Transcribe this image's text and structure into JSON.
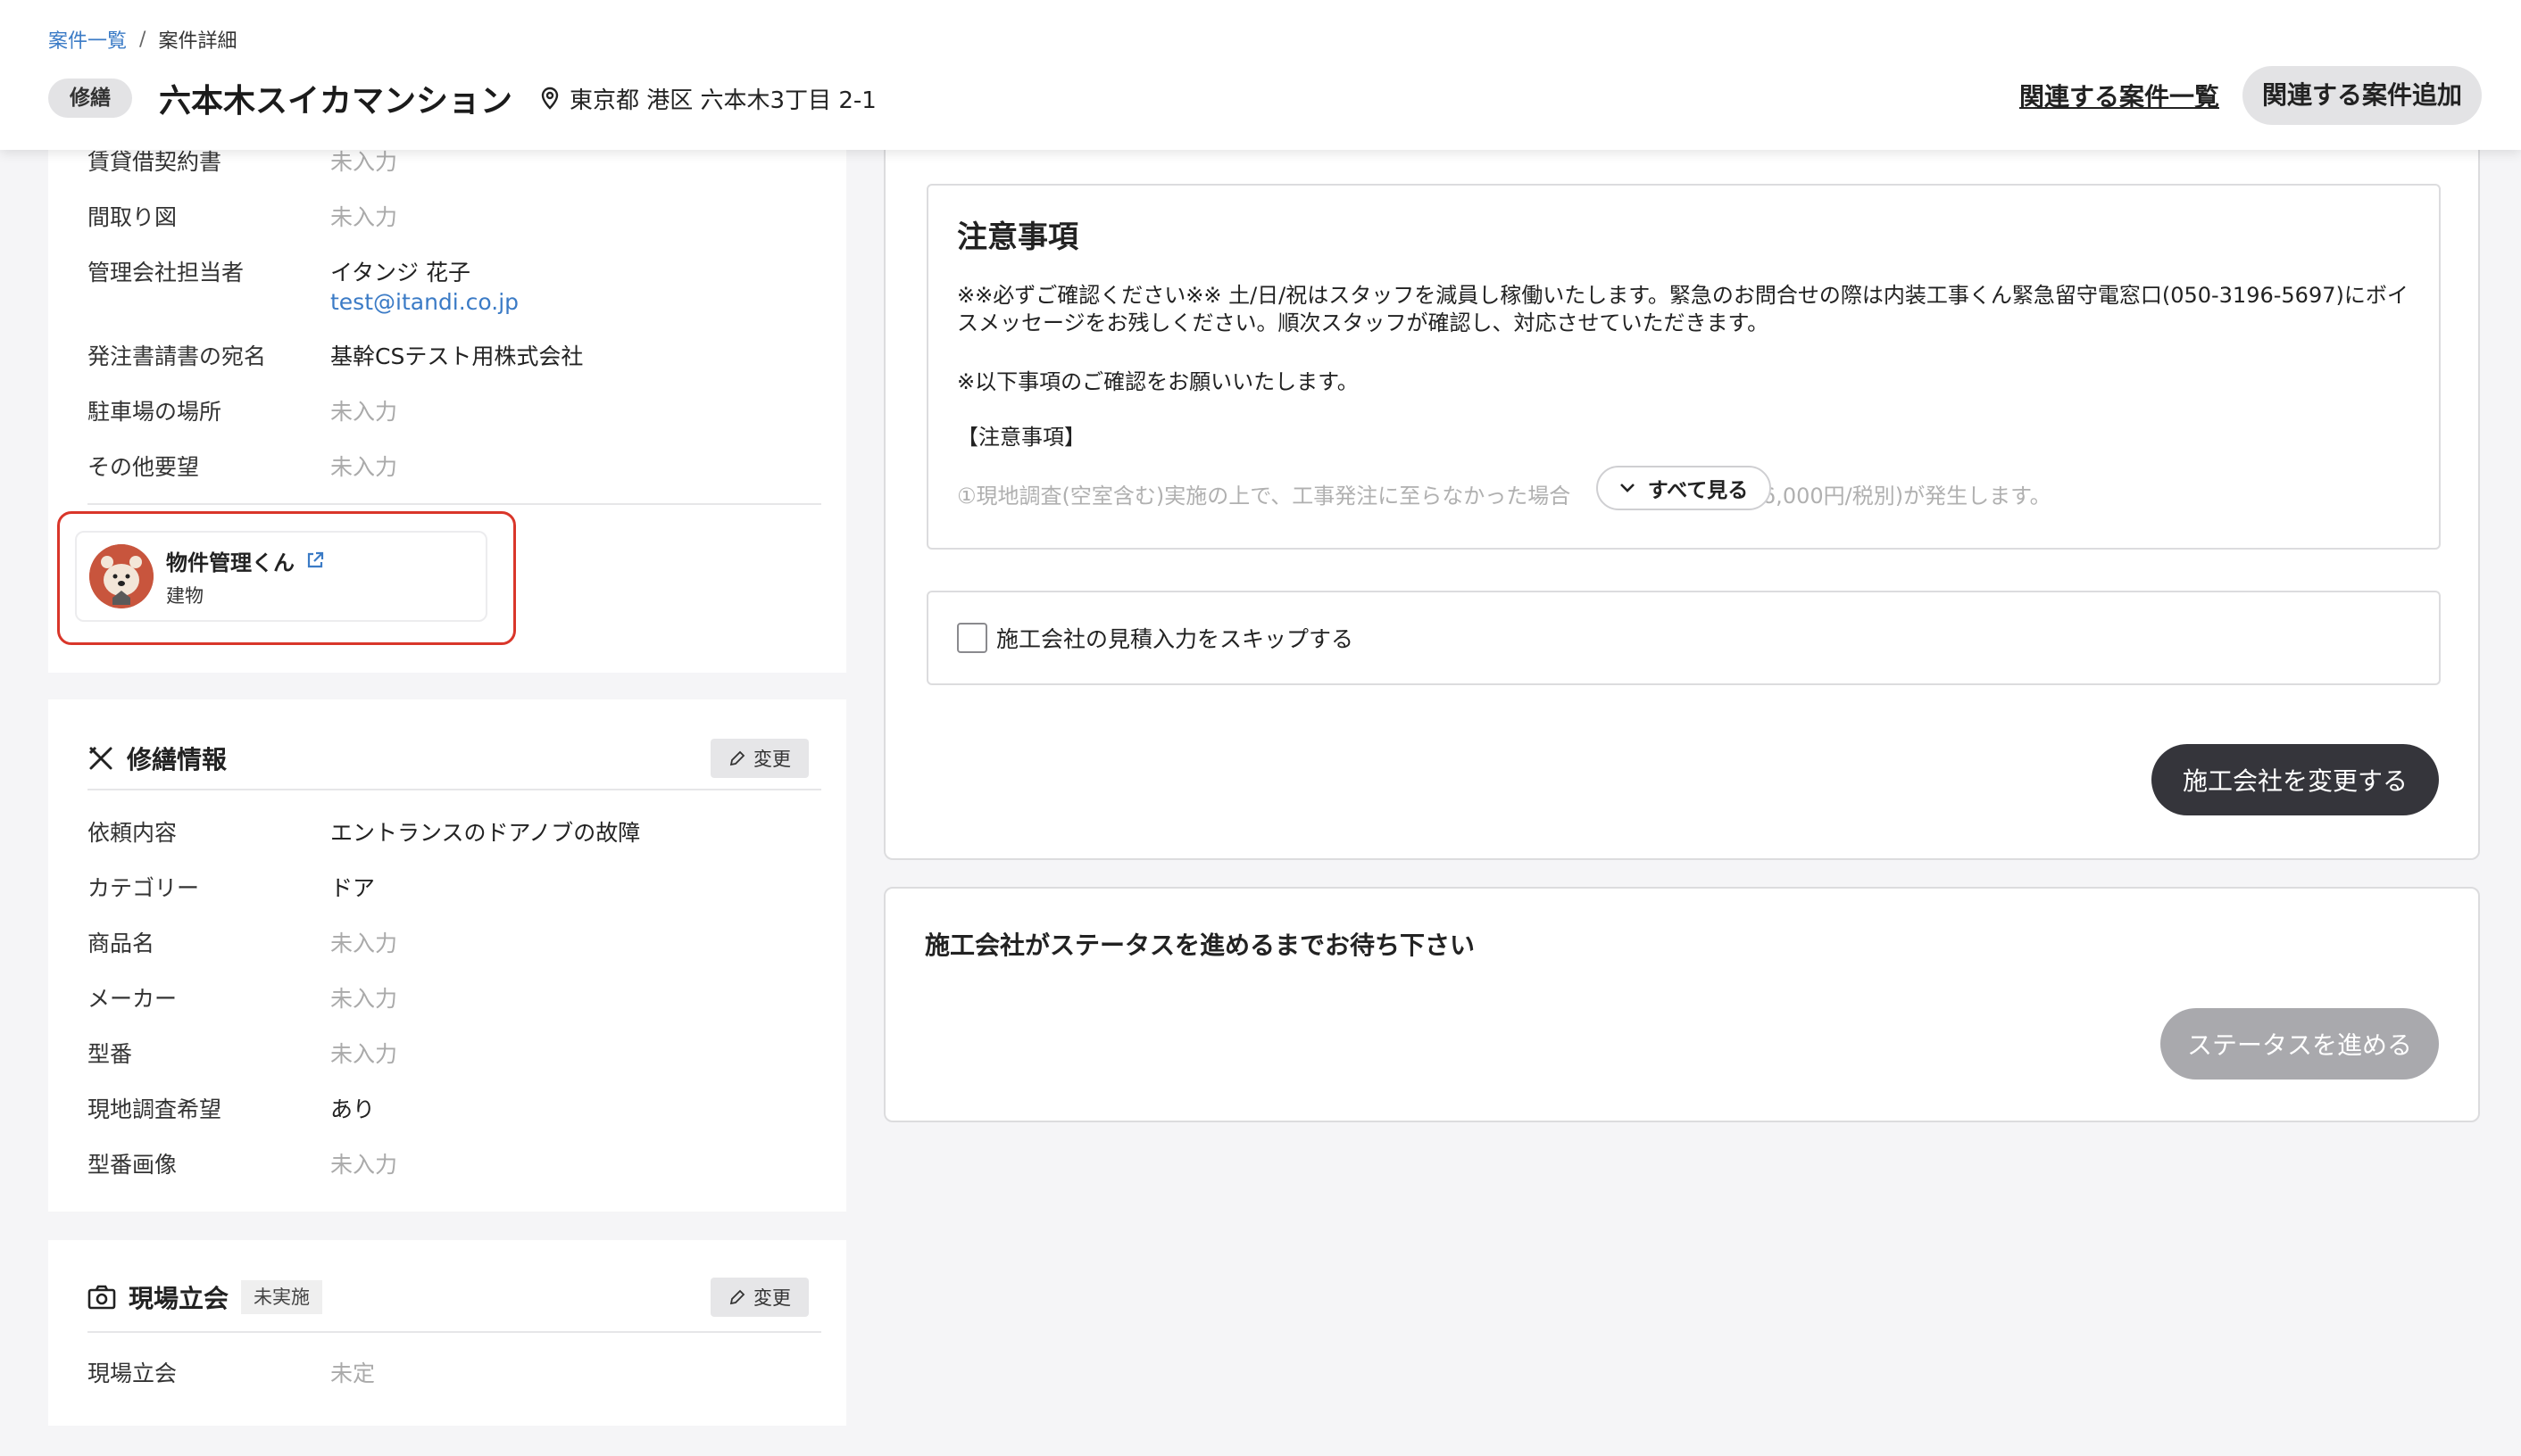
{
  "breadcrumb": {
    "list": "案件一覧",
    "separator": "/",
    "current": "案件詳細"
  },
  "header": {
    "type_badge": "修繕",
    "property_name": "六本木スイカマンション",
    "address": "東京都 港区 六本木3丁目 2-1",
    "related_list_link": "関連する案件一覧",
    "related_add_button": "関連する案件追加"
  },
  "building_info": {
    "rows": [
      {
        "label": "賃貸借契約書",
        "value": "未入力"
      },
      {
        "label": "間取り図",
        "value": "未入力"
      },
      {
        "label": "管理会社担当者",
        "value": "イタンジ 花子",
        "email": "test@itandi.co.jp"
      },
      {
        "label": "発注書請書の宛名",
        "value": "基幹CSテスト用株式会社"
      },
      {
        "label": "駐車場の場所",
        "value": "未入力"
      },
      {
        "label": "その他要望",
        "value": "未入力"
      }
    ],
    "linked_app": {
      "title": "物件管理くん",
      "subtitle": "建物",
      "icon": "external-link-icon"
    }
  },
  "repair_info": {
    "title": "修繕情報",
    "icon": "tools-icon",
    "edit_label": "変更",
    "rows": [
      {
        "label": "依頼内容",
        "value": "エントランスのドアノブの故障"
      },
      {
        "label": "カテゴリー",
        "value": "ドア"
      },
      {
        "label": "商品名",
        "value": "未入力"
      },
      {
        "label": "メーカー",
        "value": "未入力"
      },
      {
        "label": "型番",
        "value": "未入力"
      },
      {
        "label": "現地調査希望",
        "value": "あり"
      },
      {
        "label": "型番画像",
        "value": "未入力"
      }
    ]
  },
  "site_meeting": {
    "title": "現場立会",
    "icon": "camera-icon",
    "badge": "未実施",
    "edit_label": "変更",
    "rows": [
      {
        "label": "現場立会",
        "value": "未定"
      }
    ]
  },
  "notice": {
    "title": "注意事項",
    "body": "※※必ずご確認ください※※ 土/日/祝はスタッフを減員し稼働いたします。緊急のお問合せの際は内装工事くん緊急留守電窓口(050-3196-5697)にボイスメッセージをお残しください。順次スタッフが確認し、対応させていただきます。",
    "line2": "※以下事項のご確認をお願いいたします。",
    "line3": "【注意事項】",
    "faded_left": "①現地調査(空室含む)実施の上で、工事発注に至らなかった場合",
    "faded_right": "(¥6,000円/税別)が発生します。",
    "see_all": "すべて見る"
  },
  "skip_estimate": {
    "label": "施工会社の見積入力をスキップする",
    "checked": false
  },
  "change_contractor_button": "施工会社を変更する",
  "status_panel": {
    "title": "施工会社がステータスを進めるまでお待ち下さい",
    "button": "ステータスを進める"
  },
  "colors": {
    "link": "#3b7bc6",
    "highlight_border": "#d9362a",
    "primary_button": "#35353b",
    "disabled_button": "#a9a9ad"
  }
}
